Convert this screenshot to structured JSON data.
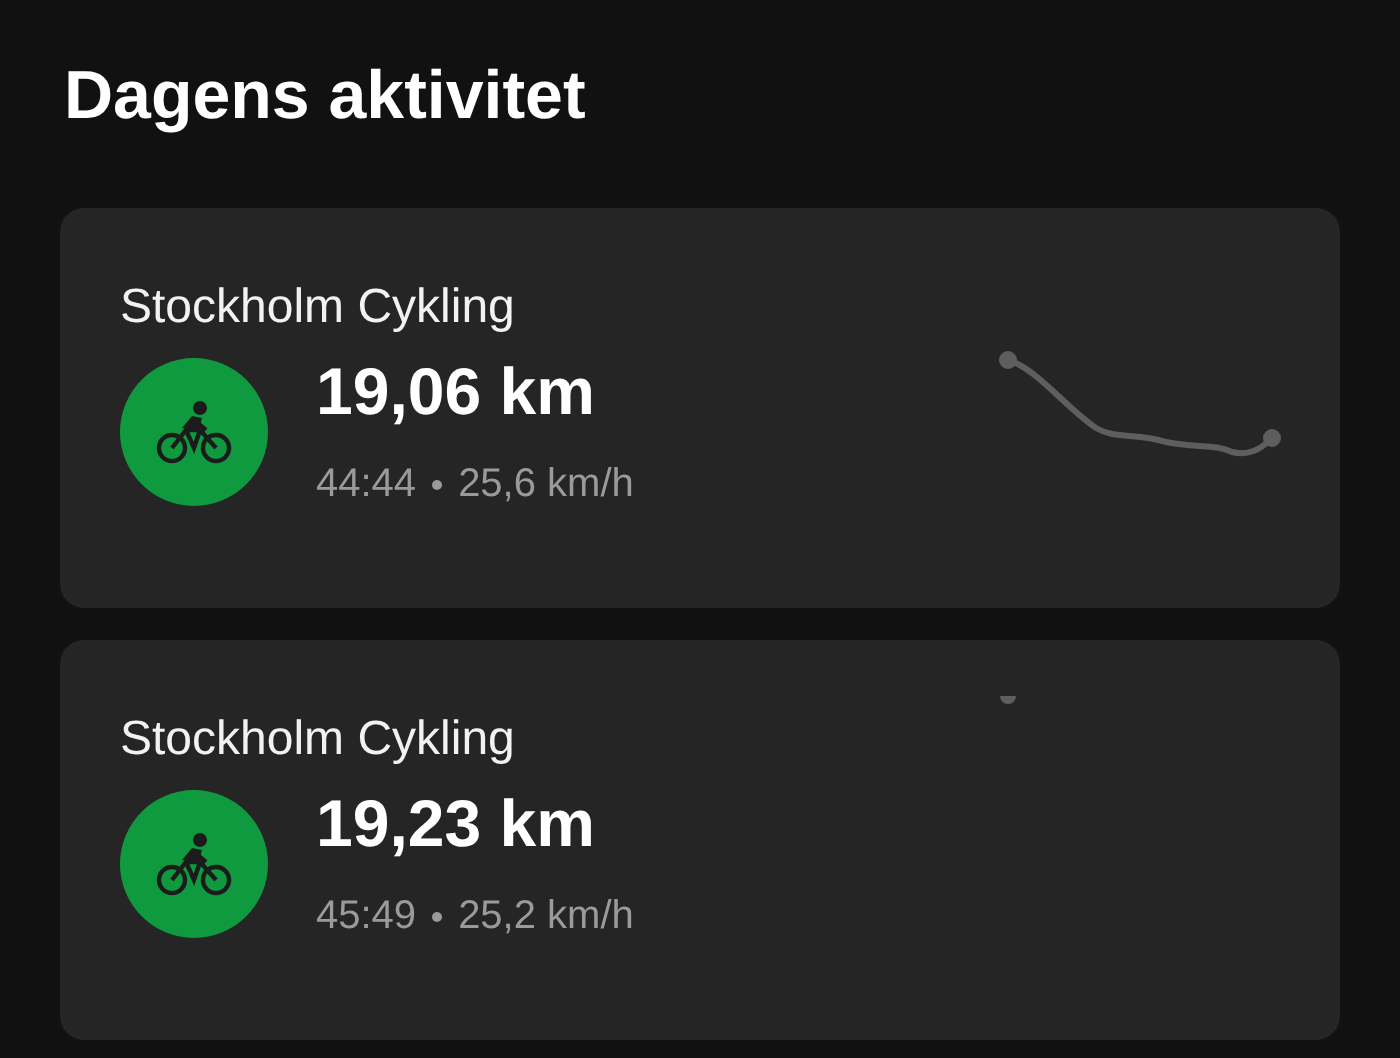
{
  "title": "Dagens aktivitet",
  "activities": [
    {
      "name": "Stockholm Cykling",
      "distance": "19,06 km",
      "duration": "44:44",
      "speed": "25,6 km/h",
      "route": {
        "kind": "track"
      }
    },
    {
      "name": "Stockholm Cykling",
      "distance": "19,23 km",
      "duration": "45:49",
      "speed": "25,2 km/h",
      "route": {
        "kind": "dot"
      }
    }
  ]
}
